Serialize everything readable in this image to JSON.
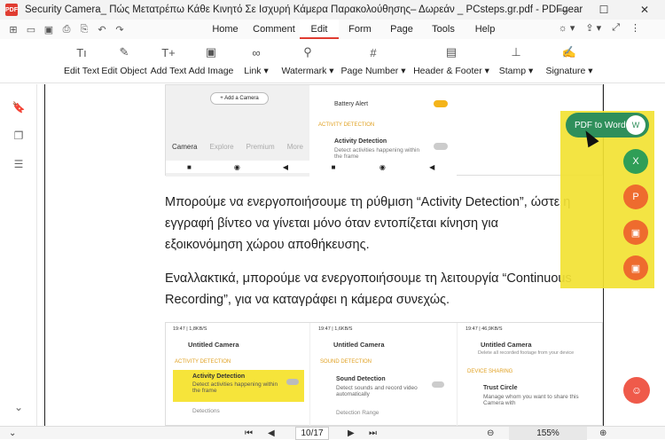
{
  "window": {
    "title": "Security Camera_ Πώς Μετατρέπω Κάθε Κινητό Σε Ισχυρή Κάμερα Παρακολούθησης– Δωρεάν _ PCsteps.gr.pdf - PDFgear",
    "app_icon_text": "PDF",
    "minimize": "—",
    "maximize": "☐",
    "close": "✕"
  },
  "quick_access": [
    "⊞",
    "▭",
    "▣",
    "⎙",
    "⎘",
    "↶",
    "↷"
  ],
  "menu_tabs": [
    "Home",
    "Comment",
    "Edit",
    "Form",
    "Page",
    "Tools",
    "Help"
  ],
  "active_tab": "Edit",
  "right_icons": [
    "☼ ▾",
    "⇪ ▾",
    "⤢",
    "⋮"
  ],
  "toolbar": [
    {
      "label": "Edit Text",
      "icon": "Tı"
    },
    {
      "label": "Edit Object",
      "icon": "✎"
    },
    {
      "label": "Add Text",
      "icon": "T+"
    },
    {
      "label": "Add Image",
      "icon": "▣"
    },
    {
      "label": "Link ▾",
      "icon": "∞"
    },
    {
      "label": "Watermark ▾",
      "icon": "⚲"
    },
    {
      "label": "Page Number ▾",
      "icon": "#"
    },
    {
      "label": "Header & Footer ▾",
      "icon": "▤"
    },
    {
      "label": "Stamp ▾",
      "icon": "⊥"
    },
    {
      "label": "Signature ▾",
      "icon": "✍"
    }
  ],
  "sidebar_icons": [
    "🔖",
    "❐",
    "☰",
    "⌄"
  ],
  "document": {
    "paragraph1": "Μπορούμε να ενεργοποιήσουμε τη ρύθμιση “Activity Detection”, ώστε η εγγραφή βίντεο να γίνεται μόνο όταν εντοπίζεται κίνηση για εξοικονόμηση χώρου αποθήκευσης.",
    "paragraph2": "Εναλλακτικά, μπορούμε να ενεργοποιήσουμε τη λειτουργία “Continuous Recording”, για να καταγράφει η κάμερα συνεχώς.",
    "top_shot": {
      "add_camera": "+ Add a Camera",
      "nav": [
        "Camera",
        "Explore",
        "Premium",
        "More"
      ],
      "battery_alert": "Battery Alert",
      "activity_header": "ACTIVITY DETECTION",
      "activity_title": "Activity Detection",
      "activity_desc": "Detect activities happening within the frame"
    },
    "bottom_shots": [
      {
        "status": "19:47 | 1,8KB/S",
        "title": "Untitled Camera",
        "section": "ACTIVITY DETECTION",
        "item_title": "Activity Detection",
        "item_desc": "Detect activities happening within the frame",
        "next": "Detections"
      },
      {
        "status": "19:47 | 1,6KB/S",
        "title": "Untitled Camera",
        "section": "SOUND DETECTION",
        "item_title": "Sound Detection",
        "item_desc": "Detect sounds and record video automatically",
        "next": "Detection Range"
      },
      {
        "status": "19:47 | 46,9KB/S",
        "title": "Untitled Camera",
        "top_text": "Delete all recorded footage from your device",
        "section": "DEVICE SHARING",
        "item_title": "Trust Circle",
        "item_desc": "Manage whom you want to share this Camera with",
        "next": ""
      }
    ]
  },
  "floating": {
    "pdf_to_word": "PDF to Word",
    "word_icon": "W",
    "buttons": [
      {
        "icon": "X",
        "color": "#2f9e57"
      },
      {
        "icon": "P",
        "color": "#ee6b2e"
      },
      {
        "icon": "▣",
        "color": "#ee6b2e"
      },
      {
        "icon": "▣",
        "color": "#ee6b2e"
      }
    ],
    "bot_icon": "☺"
  },
  "statusbar": {
    "first": "⏮",
    "prev": "◀",
    "page": "10",
    "total": "/17",
    "next": "▶",
    "last": "⏭",
    "zoom_out": "⊖",
    "zoom": "155%",
    "zoom_in": "⊕",
    "collapse": "⌄"
  }
}
